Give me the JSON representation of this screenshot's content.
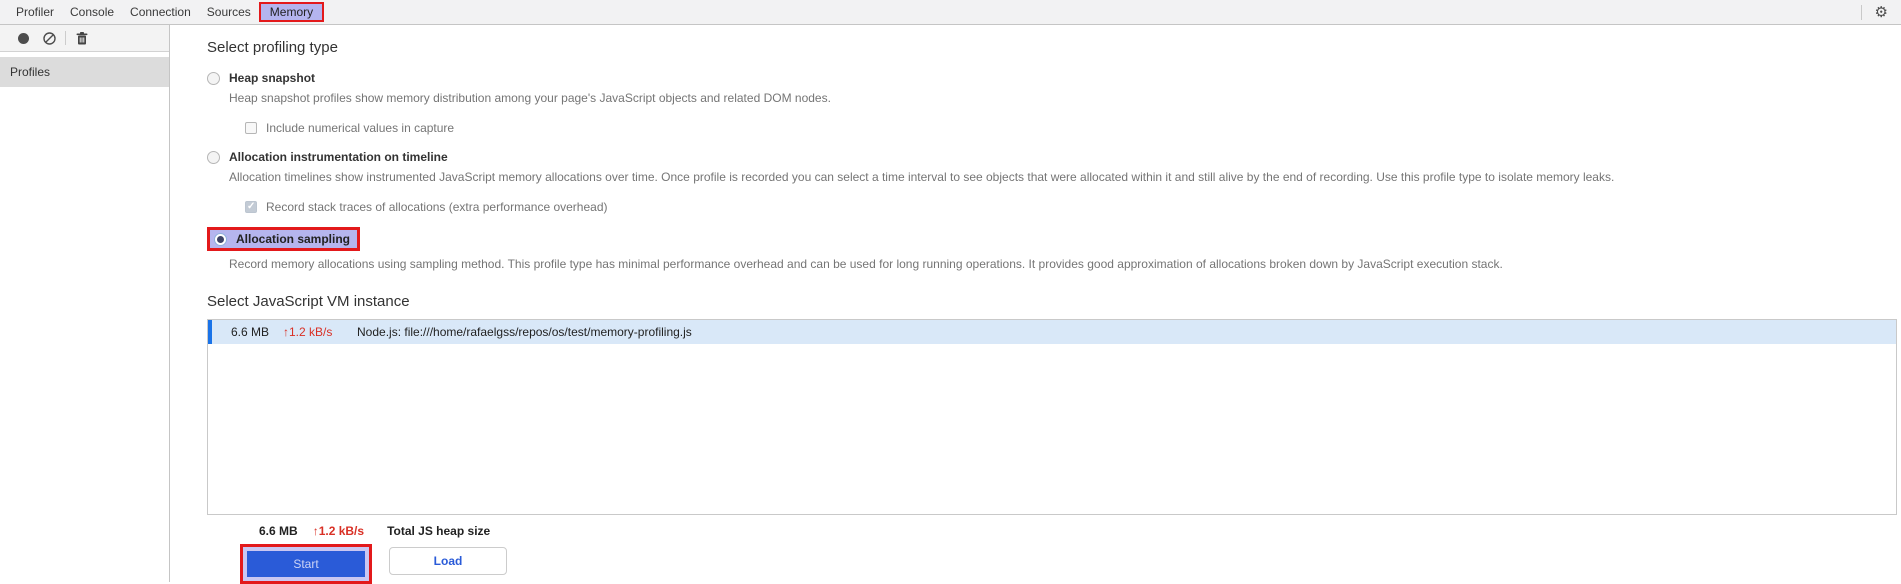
{
  "tabs": {
    "items": [
      "Profiler",
      "Console",
      "Connection",
      "Sources",
      "Memory"
    ],
    "active": "Memory"
  },
  "icons": {
    "gear": "⚙",
    "record": "record-icon",
    "block": "block-icon",
    "trash": "trash-icon"
  },
  "sidebar": {
    "header": "Profiles"
  },
  "profiling": {
    "heading": "Select profiling type",
    "options": [
      {
        "label": "Heap snapshot",
        "description": "Heap snapshot profiles show memory distribution among your page's JavaScript objects and related DOM nodes.",
        "selected": false,
        "sub_checkbox": {
          "label": "Include numerical values in capture",
          "checked": false
        }
      },
      {
        "label": "Allocation instrumentation on timeline",
        "description": "Allocation timelines show instrumented JavaScript memory allocations over time. Once profile is recorded you can select a time interval to see objects that were allocated within it and still alive by the end of recording. Use this profile type to isolate memory leaks.",
        "selected": false,
        "sub_checkbox": {
          "label": "Record stack traces of allocations (extra performance overhead)",
          "checked": true,
          "disabled": true
        }
      },
      {
        "label": "Allocation sampling",
        "description": "Record memory allocations using sampling method. This profile type has minimal performance overhead and can be used for long running operations. It provides good approximation of allocations broken down by JavaScript execution stack.",
        "selected": true,
        "highlighted": true
      }
    ]
  },
  "vm": {
    "heading": "Select JavaScript VM instance",
    "instances": [
      {
        "size": "6.6 MB",
        "rate": "↑1.2 kB/s",
        "name": "Node.js: file:///home/rafaelgss/repos/os/test/memory-profiling.js",
        "selected": true
      }
    ],
    "total": {
      "size": "6.6 MB",
      "rate": "↑1.2 kB/s",
      "label": "Total JS heap size"
    }
  },
  "actions": {
    "start": "Start",
    "load": "Load"
  },
  "colors": {
    "annotation_red": "#e3191b",
    "highlight_lavender": "#b5b5ee",
    "selection_blue": "#1a73e8",
    "row_selected_bg": "#d9e8f8",
    "rate_red": "#d93025",
    "button_blue": "#2a5bd8"
  }
}
